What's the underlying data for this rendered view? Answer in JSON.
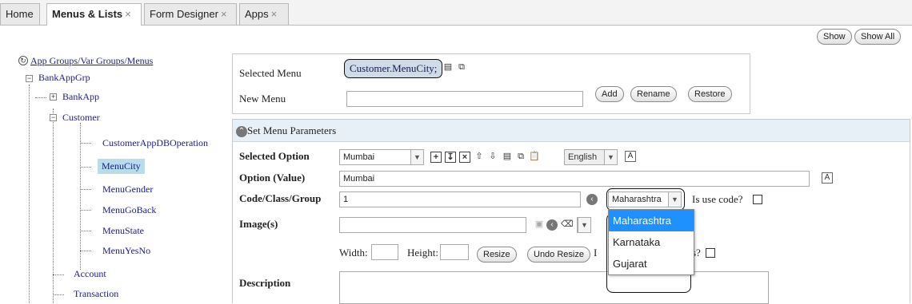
{
  "tabs": [
    {
      "label": "Home",
      "closable": false
    },
    {
      "label": "Menus & Lists",
      "closable": true
    },
    {
      "label": "Form Designer",
      "closable": true
    },
    {
      "label": "Apps",
      "closable": true
    }
  ],
  "close_glyph": "×",
  "toolbar": {
    "show_label": "Show",
    "show_all_label": "Show All"
  },
  "tree": {
    "root_label": "App Groups/Var Groups/Menus",
    "group": "BankAppGrp",
    "app1": "BankApp",
    "app2": "Customer",
    "menus": [
      "CustomerAppDBOperation",
      "MenuCity",
      "MenuGender",
      "MenuGoBack",
      "MenuState",
      "MenuYesNo"
    ],
    "app3": "Account",
    "app4": "Transaction"
  },
  "selected_menu": {
    "label": "Selected Menu",
    "value": "Customer.MenuCity;",
    "new_menu_label": "New Menu",
    "new_menu_value": "",
    "add_label": "Add",
    "rename_label": "Rename",
    "restore_label": "Restore"
  },
  "params": {
    "header": "Set Menu Parameters",
    "selected_option_label": "Selected Option",
    "selected_option_value": "Mumbai",
    "language_value": "English",
    "option_value_label": "Option (Value)",
    "option_value_value": "Mumbai",
    "code_label": "Code/Class/Group",
    "code_value": "1",
    "state_value": "Maharashtra",
    "use_code_label": "Is use code?",
    "images_label": "Image(s)",
    "width_label": "Width:",
    "height_label": "Height:",
    "resize_label": "Resize",
    "undo_resize_label": "Undo Resize",
    "partial_label_left": "I",
    "partial_label_right": "s?",
    "description_label": "Description"
  },
  "dropdown": {
    "options": [
      "Maharashtra",
      "Karnataka",
      "Gujarat"
    ],
    "highlighted": 0
  },
  "colors": {
    "accent": "#1e90ff",
    "tree_link": "#1a1a8c",
    "selected_node": "#b9dcea",
    "section_bg": "#e8f0f7"
  }
}
